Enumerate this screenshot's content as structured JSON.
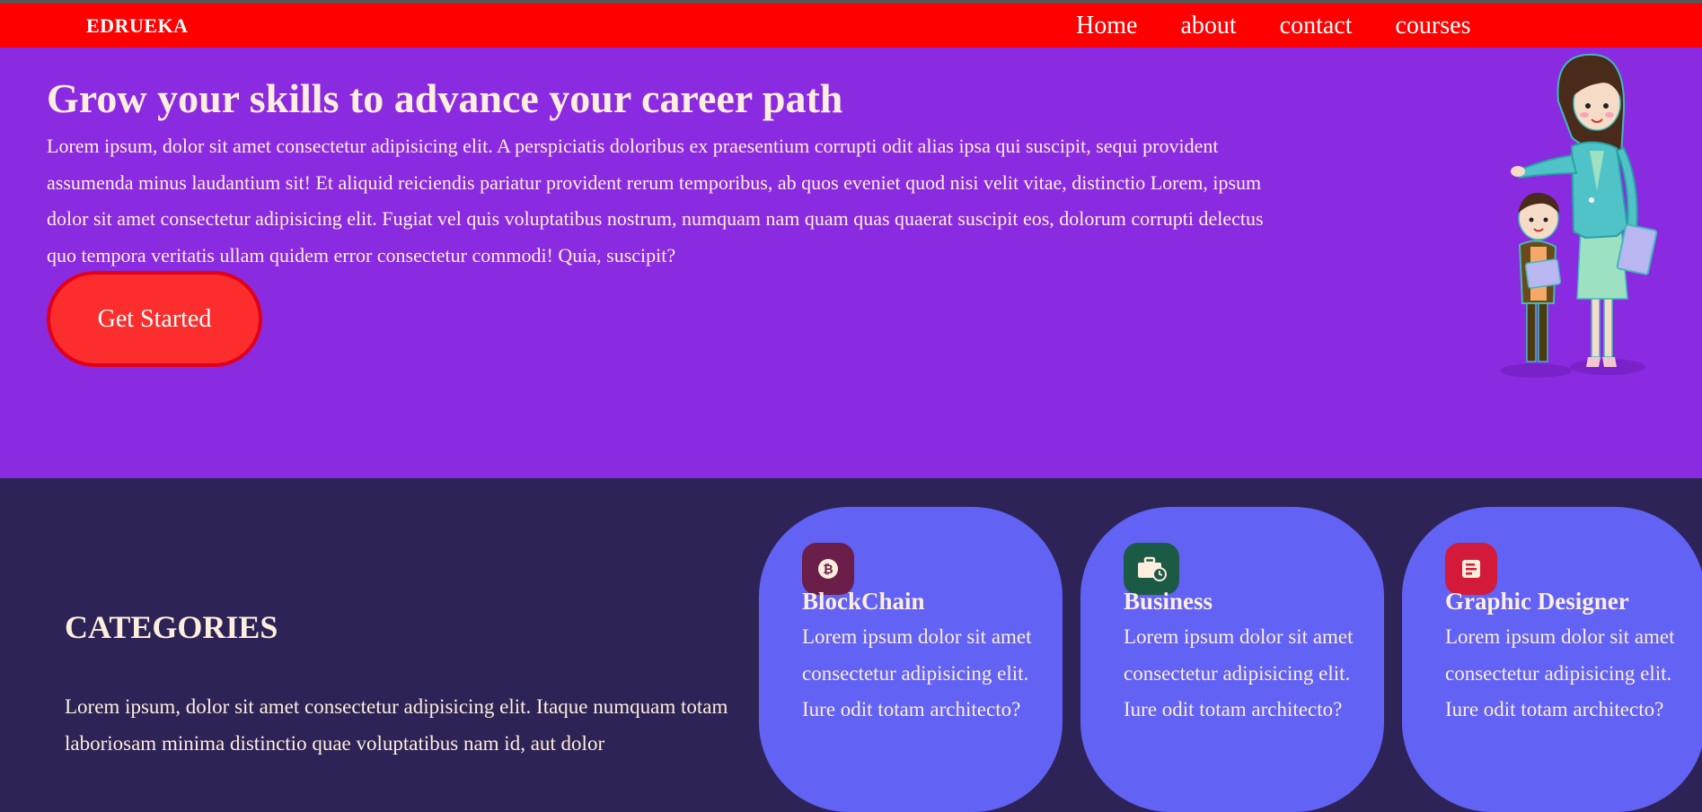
{
  "navbar": {
    "brand": "EDRUEKA",
    "links": [
      "Home",
      "about",
      "contact",
      "courses"
    ]
  },
  "hero": {
    "title": "Grow your skills to advance your career path",
    "text": "Lorem ipsum, dolor sit amet consectetur adipisicing elit. A perspiciatis doloribus ex praesentium corrupti odit alias ipsa qui suscipit, sequi provident assumenda minus laudantium sit! Et aliquid reiciendis pariatur provident rerum temporibus, ab quos eveniet quod nisi velit vitae, distinctio Lorem, ipsum dolor sit amet consectetur adipisicing elit. Fugiat vel quis voluptatibus nostrum, numquam nam quam quas quaerat suscipit eos, dolorum corrupti delectus quo tempora veritatis ullam quidem error consectetur commodi! Quia, suscipit?",
    "cta_label": "Get Started"
  },
  "categories": {
    "title": "CATEGORIES",
    "text": "Lorem ipsum, dolor sit amet consectetur adipisicing elit. Itaque numquam totam laboriosam minima distinctio quae voluptatibus nam id, aut dolor",
    "cards": [
      {
        "title": "BlockChain",
        "text": "Lorem ipsum dolor sit amet consectetur adipisicing elit. Iure odit totam architecto?",
        "icon": "bitcoin-icon",
        "icon_bg": "#6b1e4a"
      },
      {
        "title": "Business",
        "text": "Lorem ipsum dolor sit amet consectetur adipisicing elit. Iure odit totam architecto?",
        "icon": "briefcase-clock-icon",
        "icon_bg": "#1b5a45"
      },
      {
        "title": "Graphic Designer",
        "text": "Lorem ipsum dolor sit amet consectetur adipisicing elit. Iure odit totam architecto?",
        "icon": "design-doc-icon",
        "icon_bg": "#d31a3a"
      }
    ]
  },
  "colors": {
    "navbar": "#ff0000",
    "hero": "#8a2be2",
    "categories_bg": "#2d2356",
    "card": "#6262f4",
    "cta": "#fb2d2d",
    "text": "#fdeedd"
  }
}
